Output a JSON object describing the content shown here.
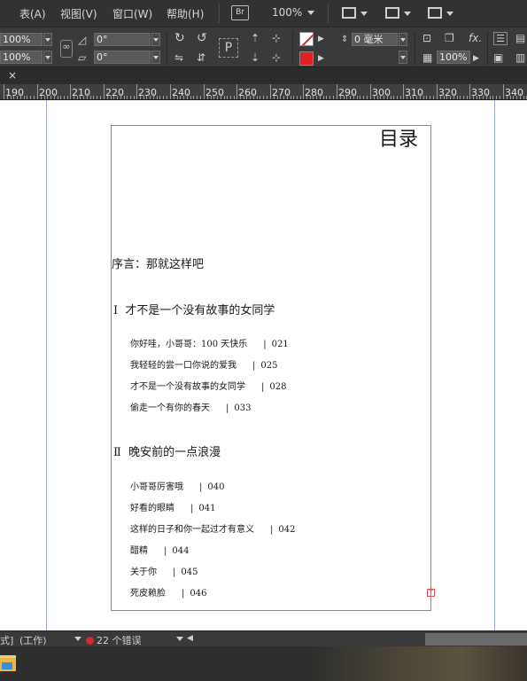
{
  "menubar": {
    "items": [
      "表(A)",
      "视图(V)",
      "窗口(W)",
      "帮助(H)"
    ],
    "bridge_label": "Br",
    "zoom": "100%"
  },
  "controlbar": {
    "scale_x": "100%",
    "scale_y": "100%",
    "rotate": "0°",
    "shear": "0°",
    "stroke_weight": "0 毫米",
    "opacity": "100%",
    "fx_label": "fx."
  },
  "tab": {
    "close_glyph": "×"
  },
  "ruler": {
    "labels": [
      "190",
      "200",
      "210",
      "220",
      "230",
      "240",
      "250",
      "260",
      "270",
      "280",
      "290",
      "300",
      "310",
      "320",
      "330",
      "340"
    ]
  },
  "document": {
    "toc_title": "目录",
    "preface": "序言：那就这样吧",
    "chapters": [
      {
        "numeral": "Ⅰ",
        "title": "才不是一个没有故事的女同学",
        "entries": [
          {
            "title": "你好哇，小哥哥：100 天快乐",
            "page": "021"
          },
          {
            "title": "我轻轻的尝一口你说的爱我",
            "page": "025"
          },
          {
            "title": "才不是一个没有故事的女同学",
            "page": "028"
          },
          {
            "title": "偷走一个有你的春天",
            "page": "033"
          }
        ]
      },
      {
        "numeral": "Ⅱ",
        "title": "晚安前的一点浪漫",
        "entries": [
          {
            "title": "小哥哥厉害哦",
            "page": "040"
          },
          {
            "title": "好看的眼睛",
            "page": "041"
          },
          {
            "title": "这样的日子和你一起过才有意义",
            "page": "042"
          },
          {
            "title": "醋精",
            "page": "044"
          },
          {
            "title": "关于你",
            "page": "045"
          },
          {
            "title": "死皮赖脸",
            "page": "046"
          }
        ]
      }
    ],
    "entry_separator": "|"
  },
  "statusbar": {
    "mode_prefix": "式]",
    "profile": "(工作)",
    "errors": "22 个错误",
    "error_color": "#d42a2a"
  }
}
